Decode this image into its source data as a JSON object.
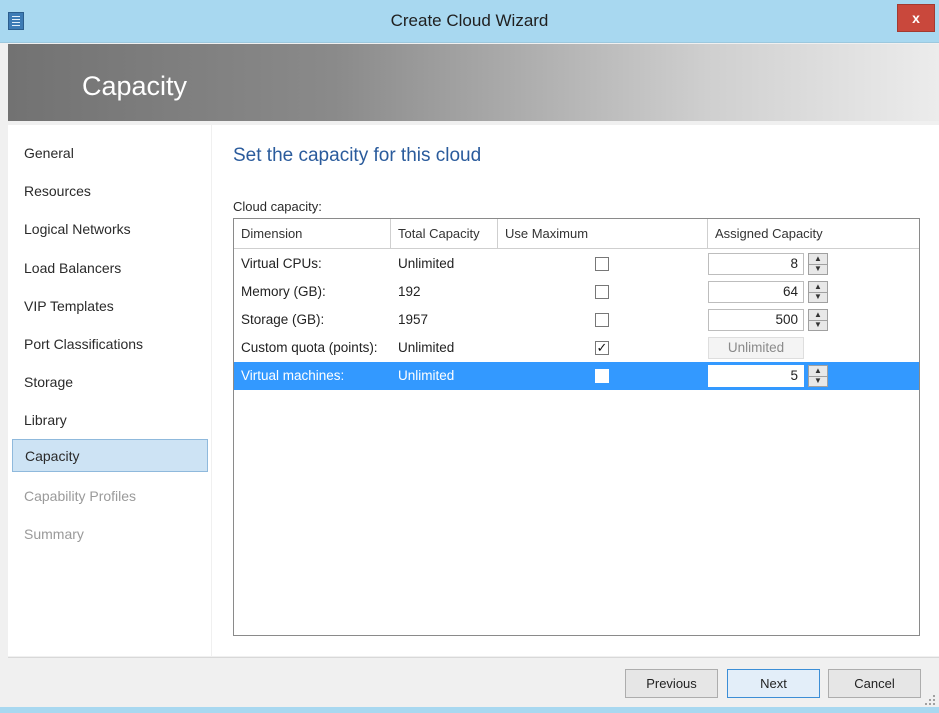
{
  "window": {
    "title": "Create Cloud Wizard",
    "close_label": "x"
  },
  "header": {
    "title": "Capacity"
  },
  "nav": {
    "items": [
      {
        "label": "General",
        "state": "normal"
      },
      {
        "label": "Resources",
        "state": "normal"
      },
      {
        "label": "Logical Networks",
        "state": "normal"
      },
      {
        "label": "Load Balancers",
        "state": "normal"
      },
      {
        "label": "VIP Templates",
        "state": "normal"
      },
      {
        "label": "Port Classifications",
        "state": "normal"
      },
      {
        "label": "Storage",
        "state": "normal"
      },
      {
        "label": "Library",
        "state": "normal"
      },
      {
        "label": "Capacity",
        "state": "active"
      },
      {
        "label": "Capability Profiles",
        "state": "disabled"
      },
      {
        "label": "Summary",
        "state": "disabled"
      }
    ]
  },
  "main": {
    "heading": "Set the capacity for this cloud",
    "grid_label": "Cloud capacity:",
    "columns": [
      "Dimension",
      "Total Capacity",
      "Use Maximum",
      "Assigned Capacity"
    ],
    "rows": [
      {
        "dimension": "Virtual CPUs:",
        "total": "Unlimited",
        "use_max": false,
        "assigned": "8",
        "selected": false
      },
      {
        "dimension": "Memory (GB):",
        "total": "192",
        "use_max": false,
        "assigned": "64",
        "selected": false
      },
      {
        "dimension": "Storage (GB):",
        "total": "1957",
        "use_max": false,
        "assigned": "500",
        "selected": false
      },
      {
        "dimension": "Custom quota (points):",
        "total": "Unlimited",
        "use_max": true,
        "assigned": "Unlimited",
        "selected": false
      },
      {
        "dimension": "Virtual machines:",
        "total": "Unlimited",
        "use_max": false,
        "assigned": "5",
        "selected": true
      }
    ]
  },
  "footer": {
    "previous_label": "Previous",
    "next_label": "Next",
    "cancel_label": "Cancel"
  },
  "colors": {
    "title_bar": "#a8d8f0",
    "selection": "#3399ff",
    "heading": "#2a5b9c",
    "nav_active": "#cde3f4"
  }
}
